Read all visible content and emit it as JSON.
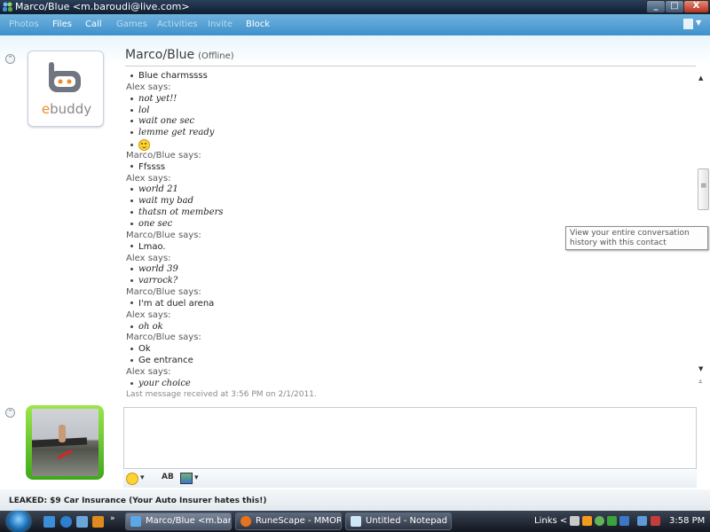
{
  "window": {
    "title": "Marco/Blue <m.baroudi@live.com>",
    "minimize_glyph": "_",
    "maximize_glyph": "□",
    "close_glyph": "X"
  },
  "toolbar": {
    "items": [
      "Photos",
      "Files",
      "Call",
      "Games",
      "Activities",
      "Invite",
      "Block"
    ]
  },
  "contact": {
    "name": "Marco/Blue",
    "status": "(Offline)",
    "avatar_brand": "ebuddy"
  },
  "conversation": {
    "lines": [
      {
        "kind": "msg",
        "sender": "marco",
        "text": "Blue charmssss"
      },
      {
        "kind": "speaker",
        "text": "Alex says:"
      },
      {
        "kind": "msg",
        "sender": "alex",
        "text": "not yet!!"
      },
      {
        "kind": "msg",
        "sender": "alex",
        "text": "lol"
      },
      {
        "kind": "msg",
        "sender": "alex",
        "text": "wait one sec"
      },
      {
        "kind": "msg",
        "sender": "alex",
        "text": "lemme get ready"
      },
      {
        "kind": "msg",
        "sender": "alex",
        "text": "",
        "emoticon": "smile-icon"
      },
      {
        "kind": "speaker",
        "text": "Marco/Blue says:"
      },
      {
        "kind": "msg",
        "sender": "marco",
        "text": "Ffssss"
      },
      {
        "kind": "speaker",
        "text": "Alex says:"
      },
      {
        "kind": "msg",
        "sender": "alex",
        "text": "world 21"
      },
      {
        "kind": "msg",
        "sender": "alex",
        "text": "wait my bad"
      },
      {
        "kind": "msg",
        "sender": "alex",
        "text": "thatsn ot members"
      },
      {
        "kind": "msg",
        "sender": "alex",
        "text": "one sec"
      },
      {
        "kind": "speaker",
        "text": "Marco/Blue says:"
      },
      {
        "kind": "msg",
        "sender": "marco",
        "text": "Lmao."
      },
      {
        "kind": "speaker",
        "text": "Alex says:"
      },
      {
        "kind": "msg",
        "sender": "alex",
        "text": "world 39"
      },
      {
        "kind": "msg",
        "sender": "alex",
        "text": "varrock?"
      },
      {
        "kind": "speaker",
        "text": "Marco/Blue says:"
      },
      {
        "kind": "msg",
        "sender": "marco",
        "text": "I'm at duel arena"
      },
      {
        "kind": "speaker",
        "text": "Alex says:"
      },
      {
        "kind": "msg",
        "sender": "alex",
        "text": "oh ok"
      },
      {
        "kind": "speaker",
        "text": "Marco/Blue says:"
      },
      {
        "kind": "msg",
        "sender": "marco",
        "text": "Ok"
      },
      {
        "kind": "msg",
        "sender": "marco",
        "text": "Ge entrance"
      },
      {
        "kind": "speaker",
        "text": "Alex says:"
      },
      {
        "kind": "msg",
        "sender": "alex",
        "text": "your choice"
      }
    ],
    "last_message": "Last message received at 3:56 PM on 2/1/2011."
  },
  "tooltip": {
    "text": "View your entire conversation history with this contact"
  },
  "compose": {
    "value": "",
    "spellcheck_label": "AB"
  },
  "status_bar": {
    "ad_text": "LEAKED: $9 Car Insurance (Your Auto Insurer hates this!)"
  },
  "taskbar": {
    "tasks": [
      {
        "label": "Marco/Blue <m.bar...",
        "icon": "messenger-icon",
        "active": true
      },
      {
        "label": "RuneScape - MMOR...",
        "icon": "firefox-icon",
        "active": false
      },
      {
        "label": "Untitled - Notepad",
        "icon": "notepad-icon",
        "active": false
      }
    ],
    "links_label": "Links",
    "clock": "3:58 PM"
  },
  "colors": {
    "toolbar": "#3f90cc",
    "compose_avatar_frame": "#5cc62a",
    "alex_text": "#222222"
  }
}
